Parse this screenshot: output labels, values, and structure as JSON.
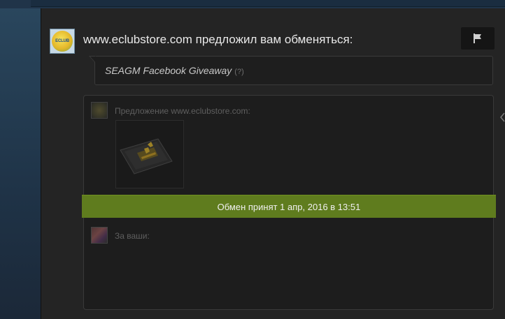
{
  "trade": {
    "header_title": "www.eclubstore.com предложил вам обменяться:",
    "message": "SEAGM Facebook Giveaway",
    "message_help": "(?)",
    "offer_label": "Предложение www.eclubstore.com:",
    "yours_label": "За ваши:",
    "status_text": "Обмен принят 1 апр, 2016 в 13:51",
    "avatar_logo_text": "ECLUB",
    "report_icon": "flag-icon"
  },
  "colors": {
    "accepted_bar": "#5f7c1e",
    "panel_bg": "#242424",
    "page_bg": "#1b2838"
  }
}
